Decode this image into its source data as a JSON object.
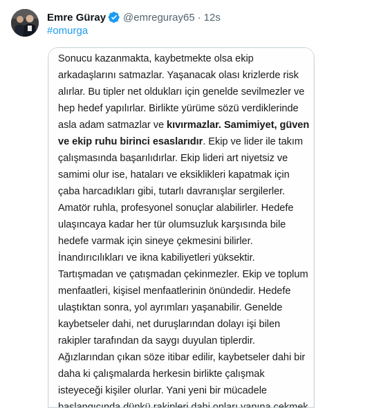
{
  "tweet": {
    "author_name": "Emre Güray",
    "handle": "@emreguray65",
    "separator": "·",
    "time": "12s",
    "hashtag": "#omurga",
    "verified_icon": "verified-badge-icon",
    "colors": {
      "link": "#1d9bf0",
      "secondary": "#536471",
      "verified": "#1d9bf0"
    }
  },
  "note": {
    "lines": [
      [
        {
          "t": "Sonucu kazanmakta, kaybetmekte olsa ekip"
        }
      ],
      [
        {
          "t": "arkadaşlarını satmazlar. Yaşanacak olası krizlerde risk"
        }
      ],
      [
        {
          "t": "alırlar. Bu tipler net oldukları için genelde sevilmezler ve"
        }
      ],
      [
        {
          "t": "hep hedef yapılırlar. Birlikte yürüme sözü verdiklerinde"
        }
      ],
      [
        {
          "t": "asla adam satmazlar ve "
        },
        {
          "t": "kıvırmazlar. Samimiyet, güven",
          "b": true
        }
      ],
      [
        {
          "t": "ve ekip ruhu birinci esaslarıdır",
          "b": true
        },
        {
          "t": ". Ekip ve lider ile takım"
        }
      ],
      [
        {
          "t": "çalışmasında başarılıdırlar. Ekip lideri art niyetsiz ve"
        }
      ],
      [
        {
          "t": "samimi olur ise, hataları ve eksiklikleri kapatmak için"
        }
      ],
      [
        {
          "t": "çaba harcadıkları gibi, tutarlı davranışlar sergilerler."
        }
      ],
      [
        {
          "t": "Amatör ruhla, profesyonel sonuçlar alabilirler. Hedefe"
        }
      ],
      [
        {
          "t": "ulaşıncaya kadar her tür olumsuzluk karşısında bile"
        }
      ],
      [
        {
          "t": "hedefe varmak için sineye çekmesini bilirler."
        }
      ],
      [
        {
          "t": "İnandırıcılıkları ve ikna kabiliyetleri yüksektir."
        }
      ],
      [
        {
          "t": "Tartışmadan ve çatışmadan çekinmezler. Ekip ve toplum"
        }
      ],
      [
        {
          "t": "menfaatleri, kişisel menfaatlerinin önündedir. Hedefe"
        }
      ],
      [
        {
          "t": "ulaştıktan sonra, yol ayrımları yaşanabilir. Genelde"
        }
      ],
      [
        {
          "t": "kaybetseler dahi, net duruşlarından dolayı işi bilen"
        }
      ],
      [
        {
          "t": "rakipler tarafından da saygı duyulan tiplerdir."
        }
      ],
      [
        {
          "t": "Ağızlarından çıkan söze itibar edilir, kaybetseler dahi bir"
        }
      ],
      [
        {
          "t": "daha ki çalışmalarda herkesin birlikte çalışmak"
        }
      ],
      [
        {
          "t": "isteyeceği kişiler olurlar. Yani yeni bir mücadele"
        }
      ],
      [
        {
          "t": "başlangıcında dünkü rakipleri dahi onları yanına çekmek,"
        }
      ]
    ]
  }
}
